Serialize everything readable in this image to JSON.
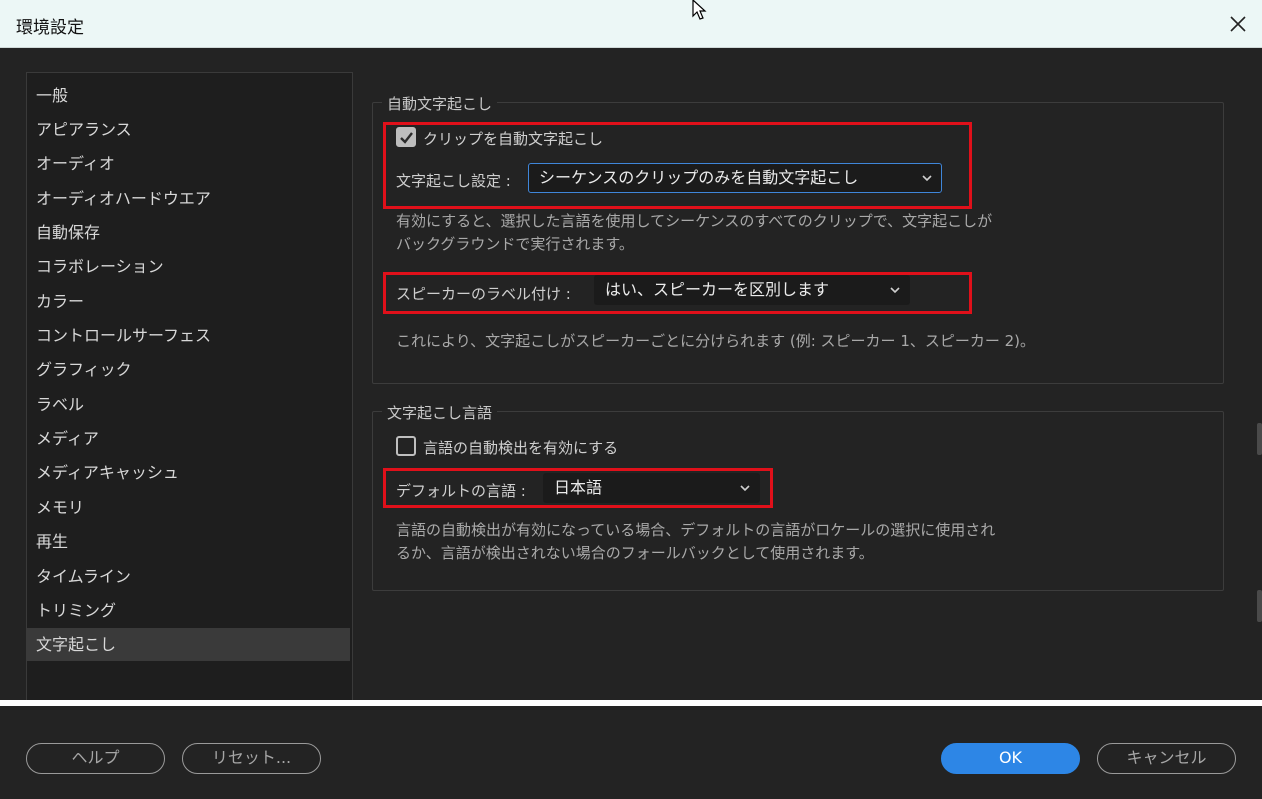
{
  "window": {
    "title": "環境設定"
  },
  "sidebar": {
    "items": [
      {
        "label": "一般"
      },
      {
        "label": "アピアランス"
      },
      {
        "label": "オーディオ"
      },
      {
        "label": "オーディオハードウエア"
      },
      {
        "label": "自動保存"
      },
      {
        "label": "コラボレーション"
      },
      {
        "label": "カラー"
      },
      {
        "label": "コントロールサーフェス"
      },
      {
        "label": "グラフィック"
      },
      {
        "label": "ラベル"
      },
      {
        "label": "メディア"
      },
      {
        "label": "メディアキャッシュ"
      },
      {
        "label": "メモリ"
      },
      {
        "label": "再生"
      },
      {
        "label": "タイムライン"
      },
      {
        "label": "トリミング"
      },
      {
        "label": "文字起こし"
      }
    ],
    "selected": "文字起こし"
  },
  "auto_transcription": {
    "group_title": "自動文字起こし",
    "checkbox_label": "クリップを自動文字起こし",
    "checkbox_checked": true,
    "setting_label": "文字起こし設定 :",
    "setting_value": "シーケンスのクリップのみを自動文字起こし",
    "description_line1": "有効にすると、選択した言語を使用してシーケンスのすべてのクリップで、文字起こしが",
    "description_line2": "バックグラウンドで実行されます。",
    "speaker_label": "スピーカーのラベル付け :",
    "speaker_value": "はい、スピーカーを区別します",
    "speaker_description": "これにより、文字起こしがスピーカーごとに分けられます (例: スピーカー 1、スピーカー 2)。"
  },
  "transcription_language": {
    "group_title": "文字起こし言語",
    "autodetect_label": "言語の自動検出を有効にする",
    "autodetect_checked": false,
    "default_label": "デフォルトの言語 :",
    "default_value": "日本語",
    "description_line1": "言語の自動検出が有効になっている場合、デフォルトの言語がロケールの選択に使用され",
    "description_line2": "るか、言語が検出されない場合のフォールバックとして使用されます。"
  },
  "footer": {
    "help": "ヘルプ",
    "reset": "リセット...",
    "ok": "OK",
    "cancel": "キャンセル"
  },
  "colors": {
    "accent": "#2d86e6",
    "highlight_box": "#e0101a",
    "background": "#232323"
  },
  "icons": [
    "close-icon",
    "cursor-icon",
    "checkmark-icon",
    "chevron-down-icon"
  ]
}
